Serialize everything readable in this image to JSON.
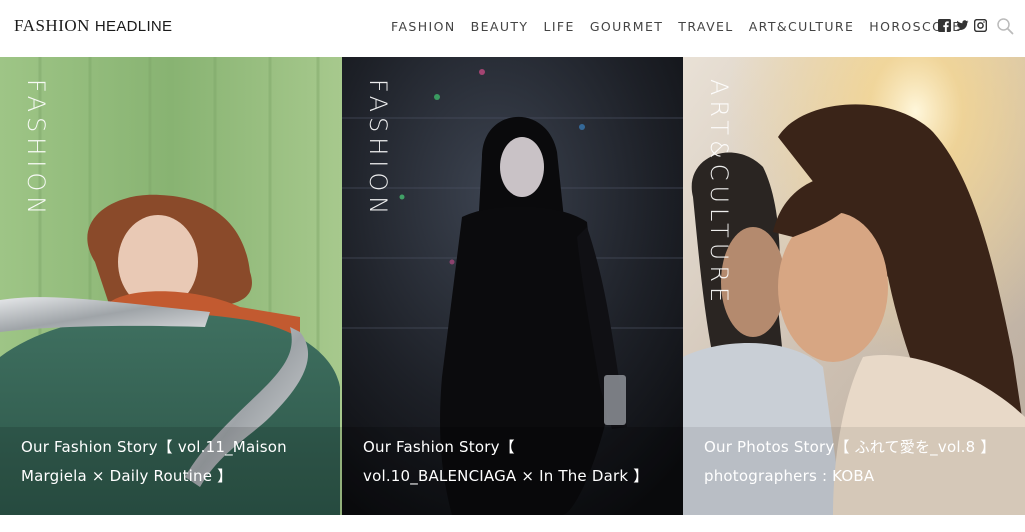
{
  "header": {
    "logo_word1": "FASHION",
    "logo_word2": "HEADLINE",
    "nav": [
      "FASHION",
      "BEAUTY",
      "LIFE",
      "GOURMET",
      "TRAVEL",
      "ART&CULTURE",
      "HOROSCOPE"
    ],
    "social_icons": [
      "facebook-icon",
      "twitter-icon",
      "instagram-icon"
    ],
    "search_icon": "search-icon"
  },
  "cards": [
    {
      "category": "FASHION",
      "title": "Our Fashion Story【 vol.11_Maison Margiela × Daily Routine 】"
    },
    {
      "category": "FASHION",
      "title": "Our Fashion Story【 vol.10_BALENCIAGA × In The Dark 】"
    },
    {
      "category": "ART&CULTURE",
      "title": "Our Photos Story【 ふれて愛を_vol.8 】photographers : KOBA"
    }
  ],
  "colors": {
    "nav_text": "#444444",
    "card1_bg": "#8fb876",
    "card2_bg": "#1a1a1e",
    "card3_bg": "#d8cbbd"
  }
}
